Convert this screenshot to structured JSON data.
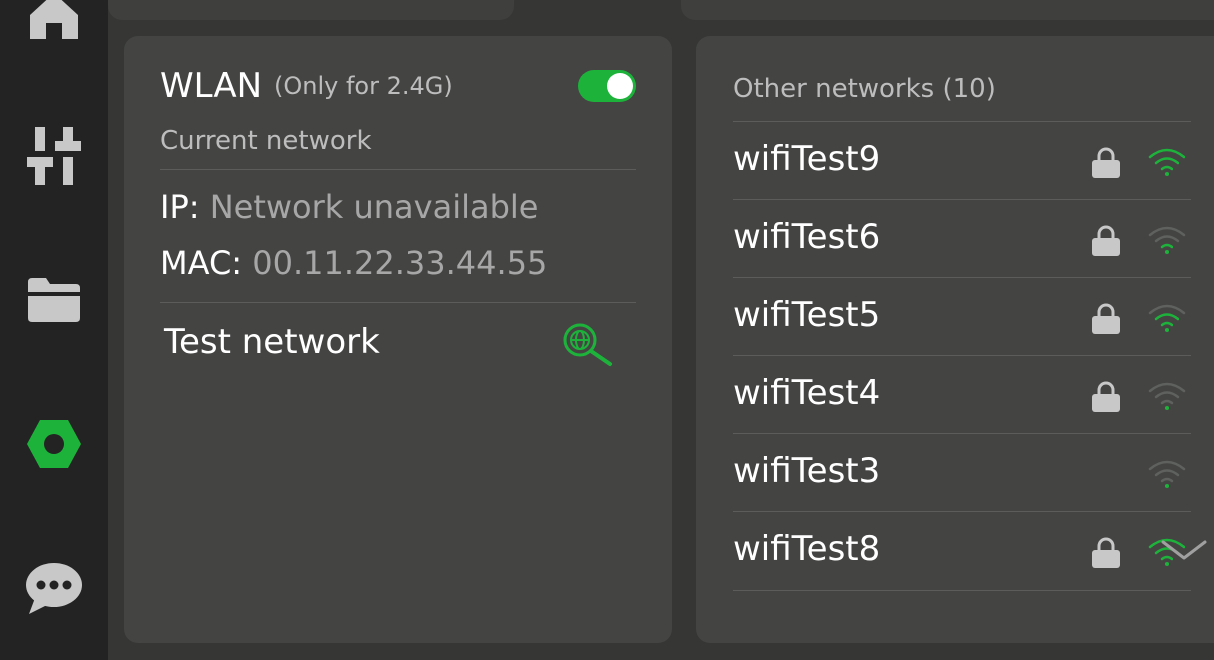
{
  "sidebar": {
    "items": [
      {
        "icon": "home-icon"
      },
      {
        "icon": "sliders-icon"
      },
      {
        "icon": "folder-icon"
      },
      {
        "icon": "settings-hex-icon",
        "active": true
      },
      {
        "icon": "chat-icon"
      }
    ]
  },
  "colors": {
    "accent": "#1db33b",
    "background": "#363735",
    "panel": "#444543",
    "sidebar": "#232323"
  },
  "wlan": {
    "title": "WLAN",
    "note": "(Only for 2.4G)",
    "enabled": true,
    "current_label": "Current network",
    "ip_label": "IP:",
    "ip_value": "Network unavailable",
    "mac_label": "MAC:",
    "mac_value": "00.11.22.33.44.55",
    "test_label": "Test network"
  },
  "networks": {
    "label": "Other networks (10)",
    "items": [
      {
        "name": "wifiTest9",
        "locked": true,
        "signal": 3
      },
      {
        "name": "wifiTest6",
        "locked": true,
        "signal": 1
      },
      {
        "name": "wifiTest5",
        "locked": true,
        "signal": 2
      },
      {
        "name": "wifiTest4",
        "locked": true,
        "signal": 0
      },
      {
        "name": "wifiTest3",
        "locked": false,
        "signal": 0
      },
      {
        "name": "wifiTest8",
        "locked": true,
        "signal": 3
      }
    ]
  }
}
